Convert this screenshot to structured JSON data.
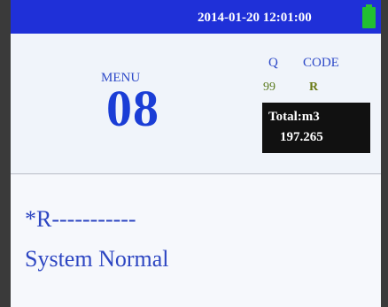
{
  "status_bar": {
    "datetime": "2014-01-20 12:01:00",
    "battery_icon": "battery-full-icon",
    "battery_color": "#22c032",
    "bar_color": "#1f30d8"
  },
  "menu": {
    "label": "MENU",
    "number": "08"
  },
  "readings": {
    "q_header": "Q",
    "code_header": "CODE",
    "q_value": "99",
    "code_value": "R"
  },
  "total": {
    "label": "Total:m3",
    "value": "197.265"
  },
  "status": {
    "code_line": "*R-----------",
    "message": "System Normal"
  }
}
